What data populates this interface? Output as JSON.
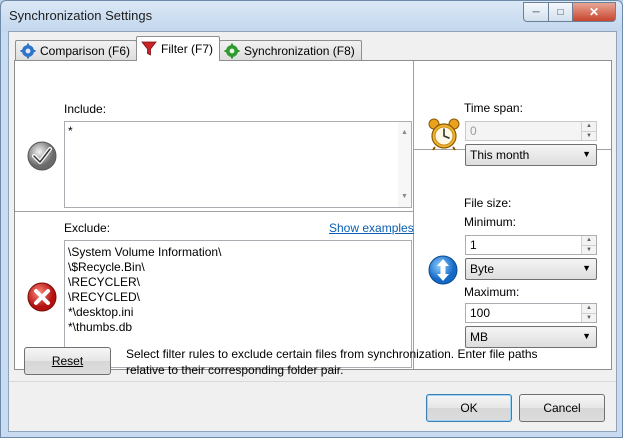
{
  "window": {
    "title": "Synchronization Settings"
  },
  "tabs": [
    {
      "label": "Comparison (F6)",
      "icon": "gear-blue-icon"
    },
    {
      "label": "Filter (F7)",
      "icon": "funnel-red-icon"
    },
    {
      "label": "Synchronization (F8)",
      "icon": "gear-green-icon"
    }
  ],
  "filter": {
    "include_label": "Include:",
    "include_value": "*",
    "exclude_label": "Exclude:",
    "show_examples": "Show examples",
    "exclude_lines": [
      "\\System Volume Information\\",
      "\\$Recycle.Bin\\",
      "\\RECYCLER\\",
      "\\RECYCLED\\",
      "*\\desktop.ini",
      "*\\thumbs.db"
    ]
  },
  "time_span": {
    "label": "Time span:",
    "value": "0",
    "unit": "This month"
  },
  "file_size": {
    "label": "File size:",
    "min_label": "Minimum:",
    "min_value": "1",
    "min_unit": "Byte",
    "max_label": "Maximum:",
    "max_value": "100",
    "max_unit": "MB"
  },
  "footer": {
    "reset_label": "Reset",
    "hint_line1": "Select filter rules to exclude certain files from synchronization. Enter file paths",
    "hint_line2": "relative to their corresponding folder pair.",
    "ok_label": "OK",
    "cancel_label": "Cancel"
  }
}
